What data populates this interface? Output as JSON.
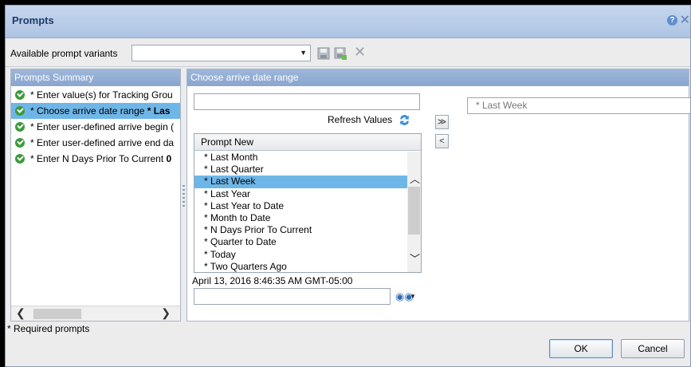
{
  "dialog": {
    "title": "Prompts",
    "help_glyph": "?",
    "close_glyph": "✕"
  },
  "variants": {
    "label": "Available prompt variants",
    "value": "",
    "delete_glyph": "✕"
  },
  "summary": {
    "header": "Prompts Summary",
    "items": [
      {
        "text": "* Enter value(s) for Tracking Grou",
        "bold": ""
      },
      {
        "text": "* Choose arrive date range ",
        "bold": "* Las"
      },
      {
        "text": "* Enter user-defined arrive begin (",
        "bold": ""
      },
      {
        "text": "* Enter user-defined arrive end da",
        "bold": ""
      },
      {
        "text": "* Enter N Days Prior To Current ",
        "bold": "0"
      }
    ],
    "scroll_left": "❮",
    "scroll_right": "❯"
  },
  "right": {
    "header": "Choose arrive date range",
    "search_value": "",
    "refresh_label": "Refresh Values",
    "list_header": "Prompt New",
    "list_items": [
      "* Last Month",
      "* Last Quarter",
      "* Last Week",
      "* Last Year",
      "* Last Year to Date",
      "* Month to Date",
      "* N Days Prior To Current",
      "* Quarter to Date",
      "* Today",
      "* Two Quarters Ago"
    ],
    "selected_index": 2,
    "timestamp": "April 13, 2016 8:46:35 AM GMT-05:00",
    "find_value": "",
    "add_glyph": "≫",
    "remove_glyph": "<",
    "selected_value": "* Last Week"
  },
  "footer": {
    "required_note": "* Required prompts",
    "ok_label": "OK",
    "cancel_label": "Cancel"
  },
  "colors": {
    "selection": "#6fb6e8",
    "header_blue": "#8aa6cf",
    "check_green": "#3d9a3d"
  }
}
